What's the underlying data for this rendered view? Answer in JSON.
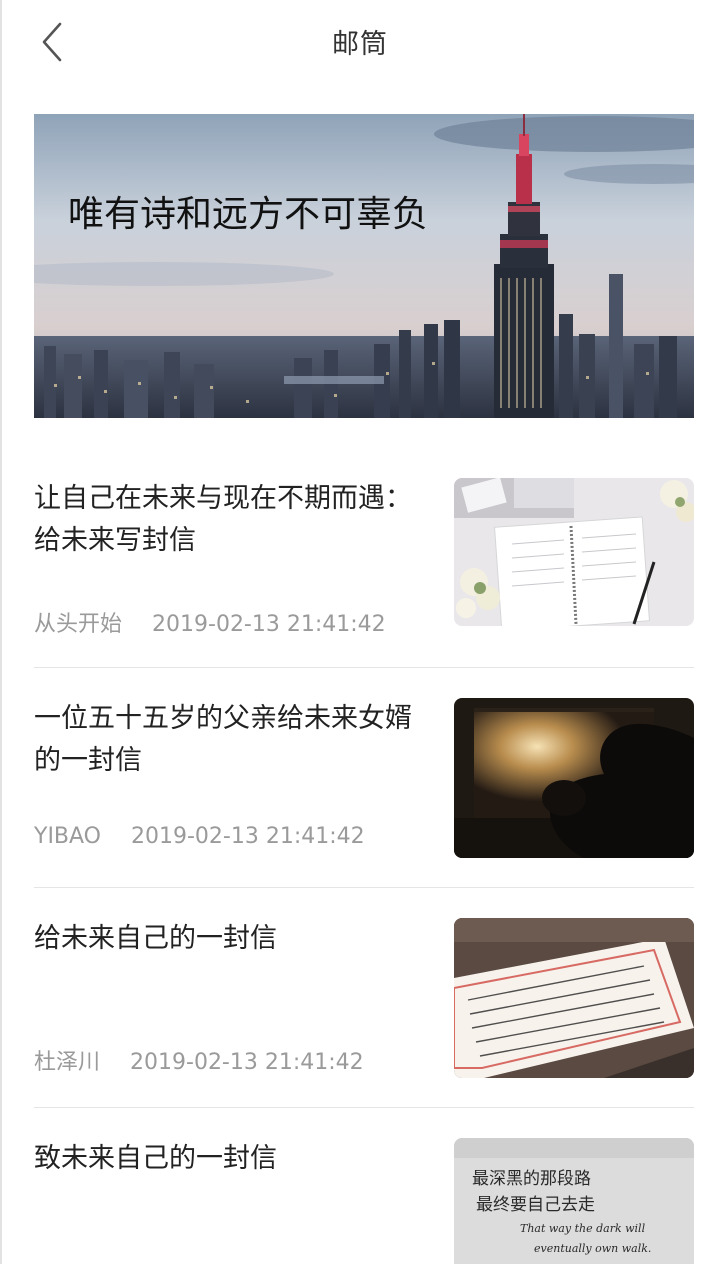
{
  "header": {
    "title": "邮筒",
    "back_icon": "chevron-left-icon"
  },
  "banner": {
    "overlay_text": "唯有诗和远方不可辜负"
  },
  "articles": [
    {
      "title_line1": "让自己在未来与现在不期而遇：",
      "title_line2": "给未来写封信",
      "author": "从头开始",
      "date": "2019-02-13 21:41:42"
    },
    {
      "title_line1": "一位五十五岁的父亲给未来女婿",
      "title_line2": "的一封信",
      "author": "YIBAO",
      "date": "2019-02-13 21:41:42"
    },
    {
      "title_line1": "给未来自己的一封信",
      "title_line2": "",
      "author": "杜泽川",
      "date": "2019-02-13 21:41:42"
    },
    {
      "title_line1": "致未来自己的一封信",
      "title_line2": "",
      "author": "",
      "date": ""
    }
  ],
  "thumb4_text": {
    "line1": "最深黑的那段路",
    "line2": "最终要自己去走",
    "line3": "That way the dark will",
    "line4": "eventually own walk."
  }
}
